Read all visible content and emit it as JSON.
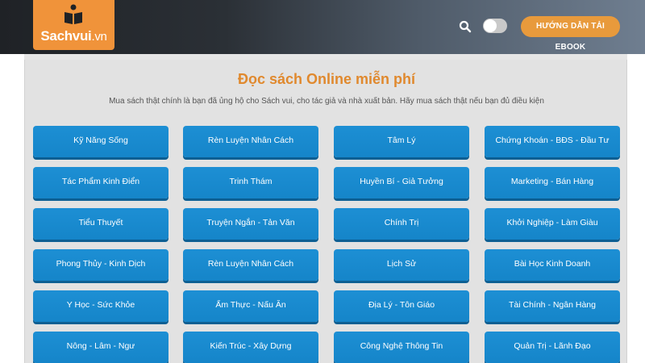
{
  "header": {
    "logo": {
      "name": "Sachvui",
      "domain": ".vn"
    },
    "guide_button": "HƯỚNG DẪN TẢI EBOOK"
  },
  "main": {
    "title": "Đọc sách Online miễn phí",
    "subtitle": "Mua sách thật chính là bạn đã ủng hộ cho Sách vui, cho tác giả và nhà xuất bản. Hãy mua sách thật nếu bạn đủ điều kiện",
    "categories": [
      "Kỹ Năng Sống",
      "Rèn Luyện Nhân Cách",
      "Tâm Lý",
      "Chứng Khoán - BĐS - Đầu Tư",
      "Tác Phẩm Kinh Điển",
      "Trinh Thám",
      "Huyền Bí - Giả Tưởng",
      "Marketing - Bán Hàng",
      "Tiểu Thuyết",
      "Truyện Ngắn - Tản Văn",
      "Chính Trị",
      "Khởi Nghiệp - Làm Giàu",
      "Phong Thủy - Kinh Dịch",
      "Rèn Luyện Nhân Cách",
      "Lịch Sử",
      "Bài Học Kinh Doanh",
      "Y Học - Sức Khỏe",
      "Ẩm Thực - Nấu Ăn",
      "Địa Lý - Tôn Giáo",
      "Tài Chính - Ngân Hàng",
      "Nông - Lâm - Ngư",
      "Kiến Trúc - Xây Dựng",
      "Công Nghệ Thông Tin",
      "Quản Trị - Lãnh Đạo"
    ]
  },
  "colors": {
    "accent_orange": "#e89a3c",
    "button_blue": "#1d8fd4",
    "title_orange": "#e0892e"
  },
  "icons": {
    "search": "search-icon",
    "theme": "moon-icon",
    "logo": "book-reader-icon"
  }
}
